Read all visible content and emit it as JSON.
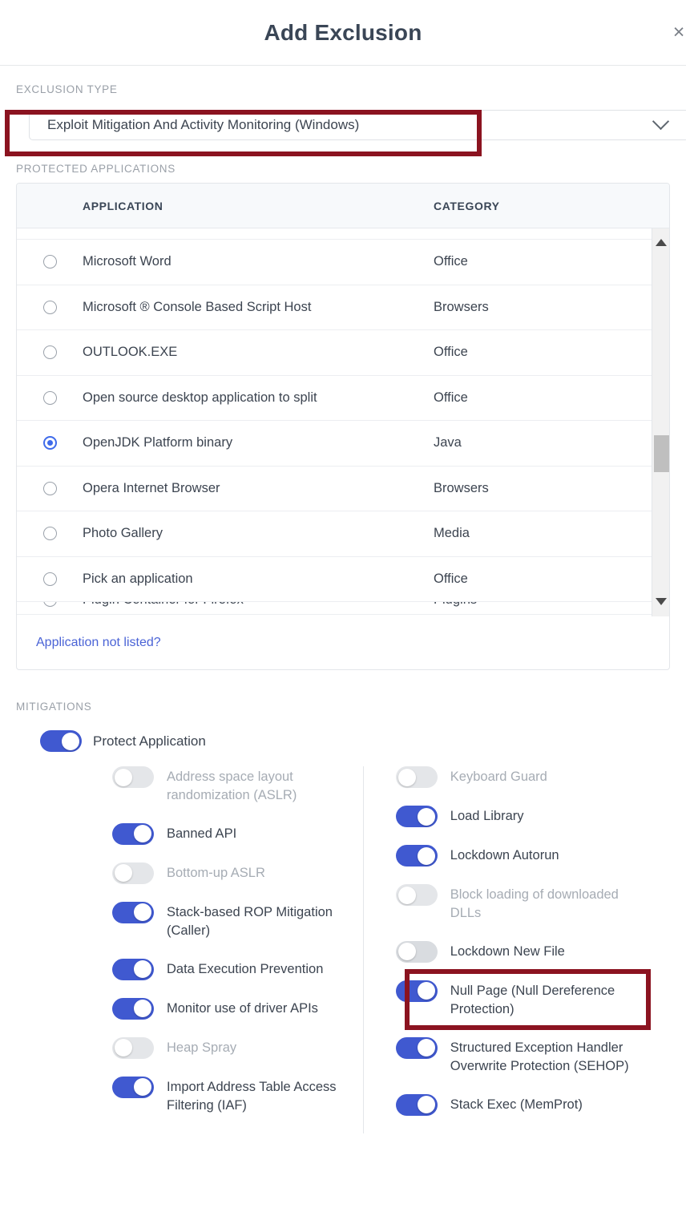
{
  "header": {
    "title": "Add Exclusion",
    "close_label": "×"
  },
  "exclusion_type": {
    "label": "EXCLUSION TYPE",
    "selected": "Exploit Mitigation And Activity Monitoring (Windows)",
    "chevron_icon": "chevron-down-icon"
  },
  "protected_applications": {
    "label": "PROTECTED APPLICATIONS",
    "columns": {
      "application": "APPLICATION",
      "category": "CATEGORY"
    },
    "rows": [
      {
        "name": "Microsoft Word",
        "category": "Office",
        "selected": false
      },
      {
        "name": "Microsoft ® Console Based Script Host",
        "category": "Browsers",
        "selected": false
      },
      {
        "name": "OUTLOOK.EXE",
        "category": "Office",
        "selected": false
      },
      {
        "name": "Open source desktop application to split",
        "category": "Office",
        "selected": false
      },
      {
        "name": "OpenJDK Platform binary",
        "category": "Java",
        "selected": true
      },
      {
        "name": "Opera Internet Browser",
        "category": "Browsers",
        "selected": false
      },
      {
        "name": "Photo Gallery",
        "category": "Media",
        "selected": false
      },
      {
        "name": "Pick an application",
        "category": "Office",
        "selected": false
      },
      {
        "name": "Plugin Container for Firefox",
        "category": "Plugins",
        "selected": false
      }
    ],
    "footer_link": "Application not listed?",
    "scrollbar": {
      "up_icon": "scroll-up-arrow-icon",
      "down_icon": "scroll-down-arrow-icon"
    }
  },
  "mitigations": {
    "label": "MITIGATIONS",
    "protect_application": {
      "label": "Protect Application",
      "on": true
    },
    "left_column": [
      {
        "label": "Address space layout randomization (ASLR)",
        "on": false,
        "disabled": true
      },
      {
        "label": "Banned API",
        "on": true,
        "disabled": false
      },
      {
        "label": "Bottom-up ASLR",
        "on": false,
        "disabled": true
      },
      {
        "label": "Stack-based ROP Mitigation (Caller)",
        "on": true,
        "disabled": false
      },
      {
        "label": "Data Execution Prevention",
        "on": true,
        "disabled": false
      },
      {
        "label": "Monitor use of driver APIs",
        "on": true,
        "disabled": false
      },
      {
        "label": "Heap Spray",
        "on": false,
        "disabled": true
      },
      {
        "label": "Import Address Table Access Filtering (IAF)",
        "on": true,
        "disabled": false
      }
    ],
    "right_column": [
      {
        "label": "Keyboard Guard",
        "on": false,
        "disabled": true
      },
      {
        "label": "Load Library",
        "on": true,
        "disabled": false
      },
      {
        "label": "Lockdown Autorun",
        "on": true,
        "disabled": false
      },
      {
        "label": "Block loading of downloaded DLLs",
        "on": false,
        "disabled": true
      },
      {
        "label": "Lockdown New File",
        "on": false,
        "disabled": false
      },
      {
        "label": "Null Page (Null Dereference Protection)",
        "on": true,
        "disabled": false
      },
      {
        "label": "Structured Exception Handler Overwrite Protection (SEHOP)",
        "on": true,
        "disabled": false
      },
      {
        "label": "Stack Exec (MemProt)",
        "on": true,
        "disabled": false
      }
    ]
  },
  "colors": {
    "highlight_red": "#8b1320",
    "toggle_on_blue": "#4059d0",
    "radio_blue": "#3f6bea",
    "link_blue": "#4a63d6",
    "title_slate": "#3a4656"
  }
}
